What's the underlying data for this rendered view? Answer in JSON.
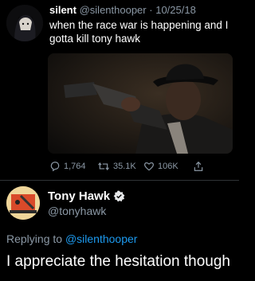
{
  "tweet": {
    "author_name": "silent",
    "handle": "@silenthooper",
    "separator": "·",
    "date": "10/25/18",
    "text": "when the race war is happening and I gotta kill tony hawk",
    "stats": {
      "replies": "1,764",
      "retweets": "35.1K",
      "likes": "106K"
    },
    "icons": {
      "reply": "reply-icon",
      "retweet": "retweet-icon",
      "like": "heart-icon",
      "share": "share-icon"
    }
  },
  "reply": {
    "author_name": "Tony Hawk",
    "handle": "@tonyhawk",
    "verified_icon": "verified-badge-icon",
    "replying_prefix": "Replying to",
    "replying_to": "@silenthooper",
    "text": "I appreciate the hesitation though"
  },
  "colors": {
    "background": "#000000",
    "text": "#ffffff",
    "muted": "#8b98a5",
    "link": "#1d9bf0"
  }
}
